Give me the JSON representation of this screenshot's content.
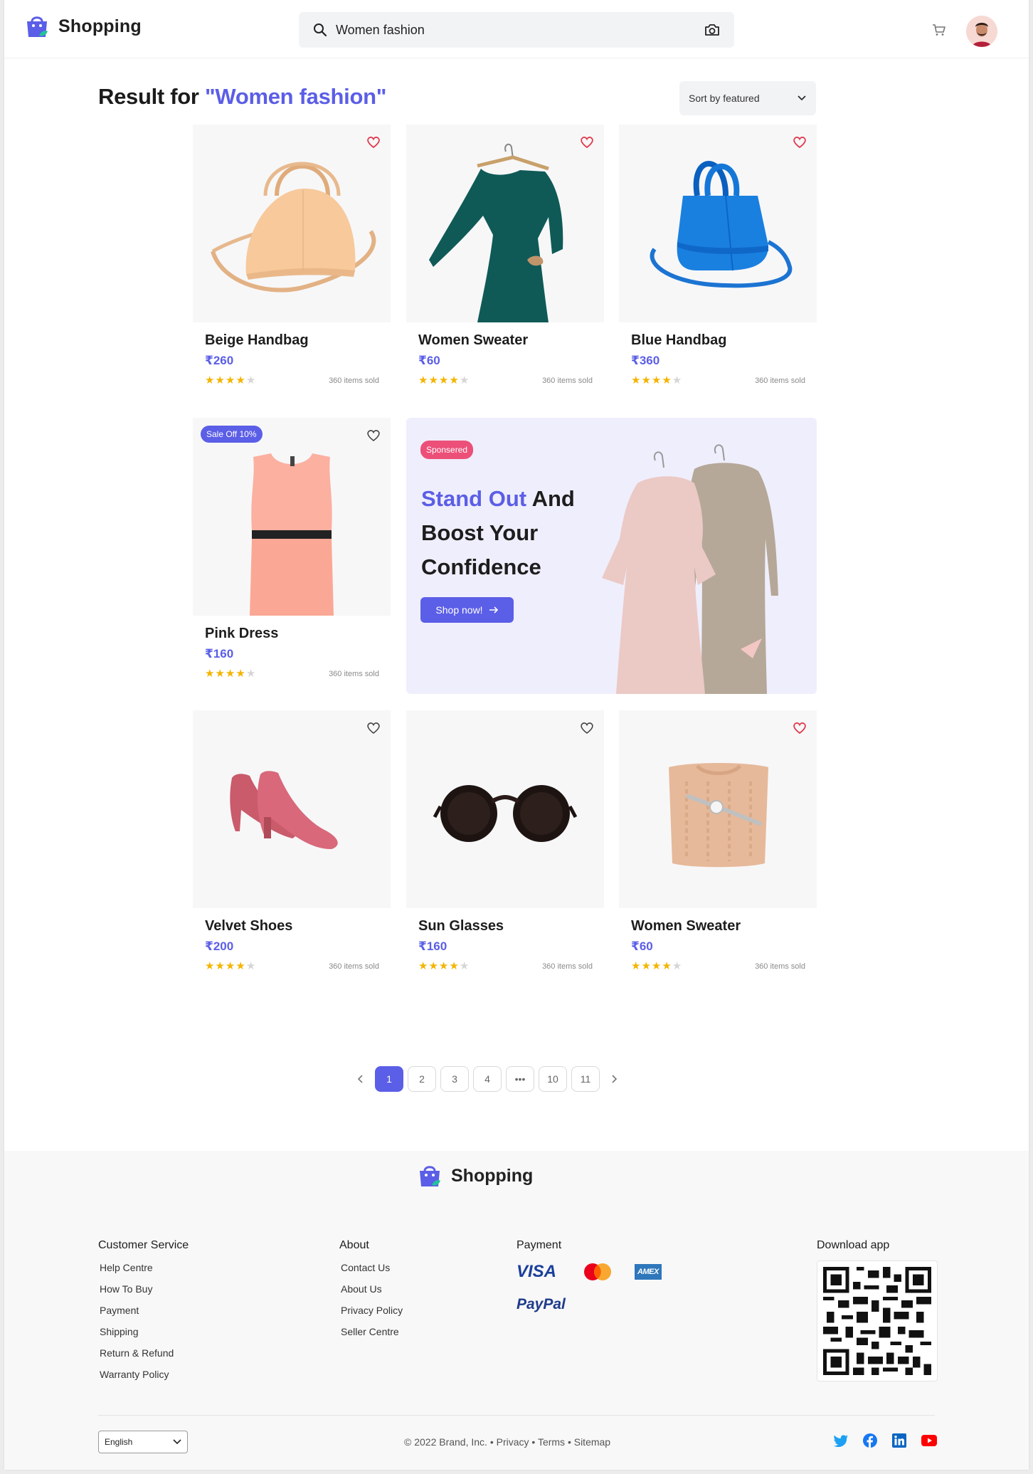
{
  "header": {
    "brand": "Shopping",
    "search_query": "Women fashion"
  },
  "results": {
    "label": "Result for",
    "query_display": "\"Women fashion\"",
    "sort_label": "Sort by featured"
  },
  "products": [
    {
      "name": "Beige Handbag",
      "price": "₹260",
      "rating": 4,
      "sold": "360 items sold",
      "favorited": true
    },
    {
      "name": "Women Sweater",
      "price": "₹60",
      "rating": 4,
      "sold": "360 items sold",
      "favorited": true
    },
    {
      "name": "Blue Handbag",
      "price": "₹360",
      "rating": 4,
      "sold": "360 items sold",
      "favorited": true
    },
    {
      "name": "Pink Dress",
      "price": "₹160",
      "rating": 4,
      "sold": "360 items sold",
      "favorited": false,
      "badge": "Sale Off 10%"
    },
    {
      "name": "Velvet Shoes",
      "price": "₹200",
      "rating": 4,
      "sold": "360 items sold",
      "favorited": false
    },
    {
      "name": "Sun Glasses",
      "price": "₹160",
      "rating": 4,
      "sold": "360 items sold",
      "favorited": false
    },
    {
      "name": "Women Sweater",
      "price": "₹60",
      "rating": 4,
      "sold": "360 items sold",
      "favorited": true
    }
  ],
  "banner": {
    "tag": "Sponsered",
    "headline_accent": "Stand Out",
    "headline_rest": " And Boost Your Confidence",
    "cta": "Shop now!"
  },
  "pagination": {
    "pages": [
      "1",
      "2",
      "3",
      "4",
      "•••",
      "10",
      "11"
    ],
    "current": "1"
  },
  "footer": {
    "brand": "Shopping",
    "customer_service": {
      "title": "Customer Service",
      "links": [
        "Help Centre",
        "How To Buy",
        "Payment",
        "Shipping",
        "Return & Refund",
        "Warranty Policy"
      ]
    },
    "about": {
      "title": "About",
      "links": [
        "Contact Us",
        "About Us",
        "Privacy Policy",
        "Seller Centre"
      ]
    },
    "payment": {
      "title": "Payment",
      "methods": [
        "VISA",
        "Mastercard",
        "AMEX",
        "PayPal"
      ]
    },
    "download": {
      "title": "Download app"
    },
    "language": "English",
    "copyright": "© 2022 Brand, Inc. • Privacy • Terms • Sitemap",
    "socials": [
      "twitter-icon",
      "facebook-icon",
      "linkedin-icon",
      "youtube-icon"
    ]
  },
  "colors": {
    "accent": "#5b5ee6",
    "sponsored": "#ec4f78",
    "favorite": "#e23b4e",
    "star": "#f4b400"
  }
}
